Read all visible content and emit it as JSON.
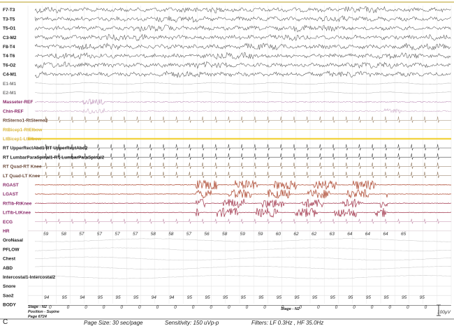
{
  "panel_letter": "C",
  "channels": [
    {
      "label": "F7-T3",
      "color": "#1a1a1a",
      "trace": "#555555",
      "kind": "eeg"
    },
    {
      "label": "T3-T5",
      "color": "#1a1a1a",
      "trace": "#555555",
      "kind": "eeg"
    },
    {
      "label": "T5-O1",
      "color": "#1a1a1a",
      "trace": "#555555",
      "kind": "eeg"
    },
    {
      "label": "C3-M2",
      "color": "#1a1a1a",
      "trace": "#555555",
      "kind": "eeg"
    },
    {
      "label": "F8-T4",
      "color": "#1a1a1a",
      "trace": "#555555",
      "kind": "eeg"
    },
    {
      "label": "T4-T6",
      "color": "#1a1a1a",
      "trace": "#555555",
      "kind": "eeg"
    },
    {
      "label": "T6-O2",
      "color": "#1a1a1a",
      "trace": "#555555",
      "kind": "eeg"
    },
    {
      "label": "C4-M1",
      "color": "#1a1a1a",
      "trace": "#555555",
      "kind": "eeg"
    },
    {
      "label": "E1-M1",
      "color": "#777777",
      "trace": "#bbbbbb",
      "kind": "eog"
    },
    {
      "label": "E2-M1",
      "color": "#777777",
      "trace": "#bbbbbb",
      "kind": "eog"
    },
    {
      "label": "Masseter-REF",
      "color": "#8a2a6a",
      "trace": "#b98bb5",
      "kind": "emg"
    },
    {
      "label": "Chin-REF",
      "color": "#8a2a6a",
      "trace": "#c9a7c4",
      "kind": "emg"
    },
    {
      "label": "RtSterno1-RtSterno2",
      "color": "#6b4a3a",
      "trace": "#a08a70",
      "kind": "ekg"
    },
    {
      "label": "RtBicep1-RtElbow",
      "color": "#d9b53a",
      "trace": "#e8d27a",
      "kind": "flat"
    },
    {
      "label": "LtBicep1-LtElbow",
      "color": "#d9b53a",
      "trace": "#f0cf30",
      "kind": "thick"
    },
    {
      "label": "RT UpperRectAbd1-RT UpperRectAbd2",
      "color": "#1a1a1a",
      "trace": "#444444",
      "kind": "ekg"
    },
    {
      "label": "RT LumbarParaSpinal1-RT LumbarParaSpinal2",
      "color": "#1a1a1a",
      "trace": "#444444",
      "kind": "ekg"
    },
    {
      "label": "RT Quad-RT Knee",
      "color": "#6b4a3a",
      "trace": "#8a7055",
      "kind": "ekg"
    },
    {
      "label": "LT Quad-LT Knee",
      "color": "#6b4a3a",
      "trace": "#8a7055",
      "kind": "ekg"
    },
    {
      "label": "RGAST",
      "color": "#8a2a6a",
      "trace": "#b3553f",
      "kind": "limb"
    },
    {
      "label": "LGAST",
      "color": "#8a2a6a",
      "trace": "#b3553f",
      "kind": "limb"
    },
    {
      "label": "RtTib-RtKnee",
      "color": "#8a2a6a",
      "trace": "#a8465a",
      "kind": "limb"
    },
    {
      "label": "LtTib-LtKnee",
      "color": "#8a2a6a",
      "trace": "#a8465a",
      "kind": "limb"
    },
    {
      "label": "ECG",
      "color": "#8a2a6a",
      "trace": "#c08aa8",
      "kind": "ecg"
    },
    {
      "label": "HR",
      "color": "#8a2a6a",
      "trace": "#d8c8d0",
      "kind": "flat"
    },
    {
      "label": "OroNasal",
      "color": "#1a1a1a",
      "trace": "#cccccc",
      "kind": "resp"
    },
    {
      "label": "PFLOW",
      "color": "#1a1a1a",
      "trace": "#cccccc",
      "kind": "resp"
    },
    {
      "label": "Chest",
      "color": "#1a1a1a",
      "trace": "#cccccc",
      "kind": "resp"
    },
    {
      "label": "ABD",
      "color": "#1a1a1a",
      "trace": "#cccccc",
      "kind": "resp"
    },
    {
      "label": "Intercostal1-Intercostal2",
      "color": "#1a1a1a",
      "trace": "#cccccc",
      "kind": "resp"
    },
    {
      "label": "Snore",
      "color": "#1a1a1a",
      "trace": "#dddddd",
      "kind": "flat"
    },
    {
      "label": "Sao2",
      "color": "#1a1a1a",
      "trace": "#dddddd",
      "kind": "flat"
    },
    {
      "label": "BODY",
      "color": "#1a1a1a",
      "trace": "#222222",
      "kind": "body"
    }
  ],
  "hr_values": [
    "59",
    "58",
    "57",
    "57",
    "57",
    "57",
    "58",
    "58",
    "57",
    "56",
    "58",
    "59",
    "59",
    "60",
    "62",
    "62",
    "63",
    "64",
    "64",
    "64",
    "65"
  ],
  "sao2_values": [
    "94",
    "95",
    "94",
    "95",
    "95",
    "95",
    "94",
    "94",
    "95",
    "95",
    "95",
    "95",
    "95",
    "95",
    "95",
    "95",
    "95",
    "95",
    "95",
    "95",
    "95",
    "95"
  ],
  "body_values": [
    "0",
    "0",
    "0",
    "0",
    "0",
    "0",
    "0",
    "0",
    "0",
    "0",
    "0",
    "0",
    "0",
    "0",
    "0",
    "0",
    "0",
    "0",
    "0",
    "0",
    "0",
    "0"
  ],
  "stage_left": "Stage - N2",
  "position_label": "Position - Supine",
  "page_label": "Page 6724",
  "stage_right": "Stage - N2",
  "scale_label": "100µV",
  "footer": {
    "page_size": "Page Size: 30 sec/page",
    "sensitivity": "Sensitivity:  150 uVp-p",
    "filters": "Filters: LF  0.3Hz , HF 35.0Hz"
  }
}
